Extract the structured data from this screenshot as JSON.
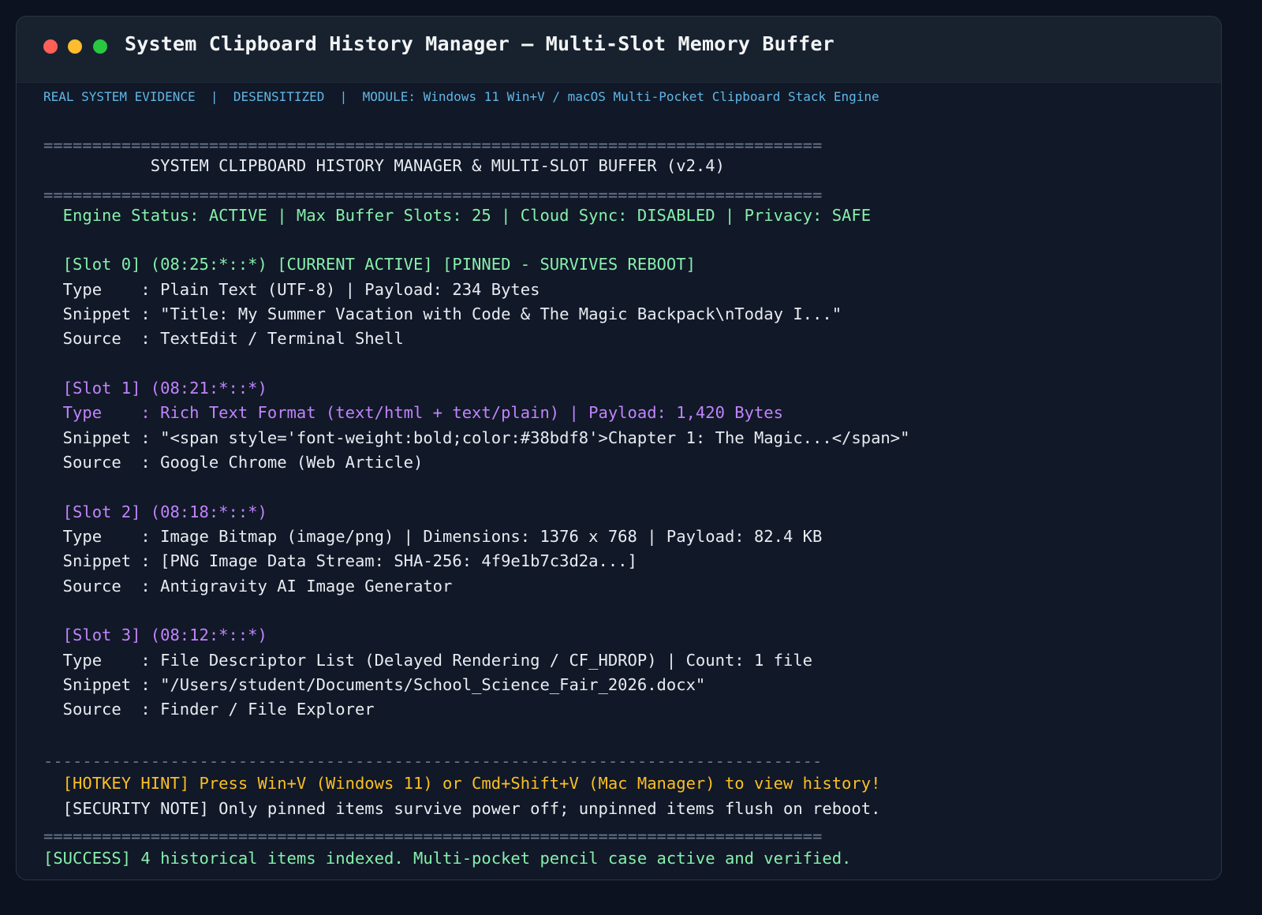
{
  "window": {
    "title": "System Clipboard History Manager — Multi-Slot Memory Buffer"
  },
  "meta": {
    "line": "REAL SYSTEM EVIDENCE  |  DESENSITIZED  |  MODULE: Windows 11 Win+V / macOS Multi-Pocket Clipboard Stack Engine"
  },
  "terminal": {
    "rule_double": "================================================================================",
    "rule_single": "--------------------------------------------------------------------------------",
    "header": "           SYSTEM CLIPBOARD HISTORY MANAGER & MULTI-SLOT BUFFER (v2.4)",
    "status": "  Engine Status: ACTIVE | Max Buffer Slots: 25 | Cloud Sync: DISABLED | Privacy: SAFE",
    "slots": [
      {
        "header": "  [Slot 0] (08:25:*::*) [CURRENT ACTIVE] [PINNED - SURVIVES REBOOT]",
        "type": "  Type    : Plain Text (UTF-8) | Payload: 234 Bytes",
        "snippet": "  Snippet : \"Title: My Summer Vacation with Code & The Magic Backpack\\nToday I...\"",
        "source": "  Source  : TextEdit / Terminal Shell"
      },
      {
        "header": "  [Slot 1] (08:21:*::*)",
        "type": "  Type    : Rich Text Format (text/html + text/plain) | Payload: 1,420 Bytes",
        "snippet": "  Snippet : \"<span style='font-weight:bold;color:#38bdf8'>Chapter 1: The Magic...</span>\"",
        "source": "  Source  : Google Chrome (Web Article)"
      },
      {
        "header": "  [Slot 2] (08:18:*::*)",
        "type": "  Type    : Image Bitmap (image/png) | Dimensions: 1376 x 768 | Payload: 82.4 KB",
        "snippet": "  Snippet : [PNG Image Data Stream: SHA-256: 4f9e1b7c3d2a...]",
        "source": "  Source  : Antigravity AI Image Generator"
      },
      {
        "header": "  [Slot 3] (08:12:*::*)",
        "type": "  Type    : File Descriptor List (Delayed Rendering / CF_HDROP) | Count: 1 file",
        "snippet": "  Snippet : \"/Users/student/Documents/School_Science_Fair_2026.docx\"",
        "source": "  Source  : Finder / File Explorer"
      }
    ],
    "hotkey_hint": "  [HOTKEY HINT] Press Win+V (Windows 11) or Cmd+Shift+V (Mac Manager) to view history!",
    "security_note": "  [SECURITY NOTE] Only pinned items survive power off; unpinned items flush on reboot.",
    "success": "[SUCCESS] 4 historical items indexed. Multi-pocket pencil case active and verified."
  },
  "colors": {
    "background": "#0d1220",
    "window_bg": "#111827",
    "titlebar_bg": "#18222f",
    "meta_blue": "#60b7e6",
    "green": "#86efac",
    "purple": "#c084fc",
    "yellow": "#fbbf24",
    "white": "#e8ecf2",
    "rule_gray": "#6b7a8f"
  },
  "icons": [
    "close-dot-icon",
    "minimize-dot-icon",
    "maximize-dot-icon"
  ]
}
